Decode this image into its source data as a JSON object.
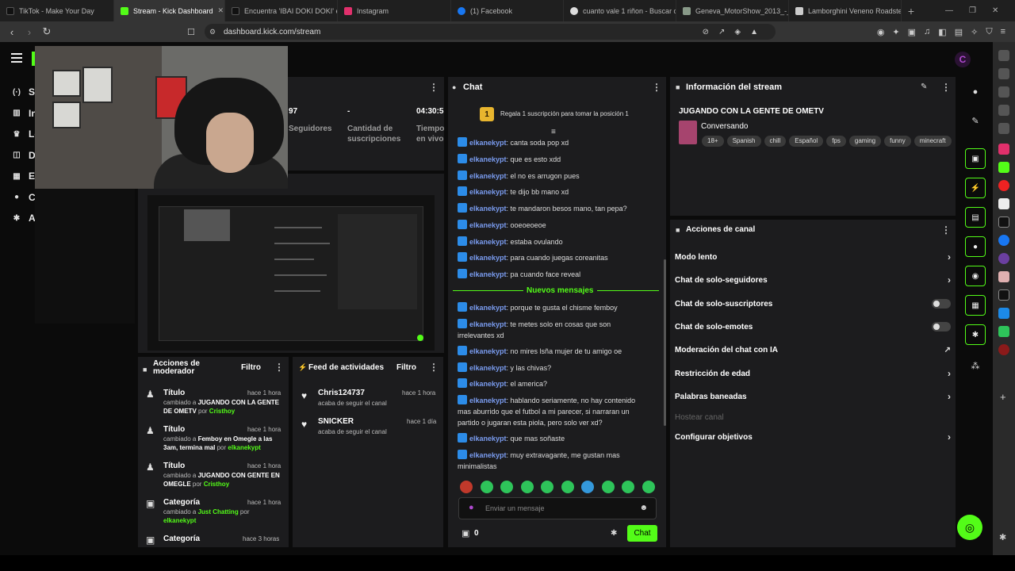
{
  "browser": {
    "tabs": [
      {
        "label": "TikTok - Make Your Day",
        "color": "#111111"
      },
      {
        "label": "Stream - Kick Dashboard",
        "color": "#53fc18",
        "active": true
      },
      {
        "label": "Encuentra 'IBAI DOKI DOKI' en",
        "color": "#111111"
      },
      {
        "label": "Instagram",
        "color": "#e1306c"
      },
      {
        "label": "(1) Facebook",
        "color": "#1877f2"
      },
      {
        "label": "cuanto vale 1 riñon - Buscar co",
        "color": "#dddddd"
      },
      {
        "label": "Geneva_MotorShow_2013_-_La",
        "color": "#889988"
      },
      {
        "label": "Lamborghini Veneno Roadster",
        "color": "#cccccc"
      }
    ],
    "url": "dashboard.kick.com/stream"
  },
  "sidebar": {
    "items": [
      {
        "label": "Str",
        "icon": "broadcast-icon"
      },
      {
        "label": "In",
        "icon": "chart-icon"
      },
      {
        "label": "Lo",
        "icon": "trophy-icon"
      },
      {
        "label": "Dr",
        "icon": "drops-icon"
      },
      {
        "label": "Es",
        "icon": "stats-icon"
      },
      {
        "label": "Canal",
        "icon": "user-icon"
      },
      {
        "label": "Ajustes",
        "icon": "gear-icon"
      }
    ]
  },
  "stats": {
    "followers_value": "97",
    "followers_label": "Seguidores",
    "subs_value": "-",
    "subs_label": "Cantidad de suscripciones",
    "live_value": "04:30:5",
    "live_label": "Tiempo en vivo"
  },
  "mod_actions": {
    "title": "Acciones de moderador",
    "filter": "Filtro",
    "items": [
      {
        "title": "Título",
        "time": "hace 1 hora",
        "pre": "cambiado a ",
        "value": "JUGANDO CON LA GENTE DE OMETV",
        "by": " por ",
        "user": "Cristhoy"
      },
      {
        "title": "Título",
        "time": "hace 1 hora",
        "pre": "cambiado a ",
        "value": "Femboy en Omegle a las 3am, termina mal",
        "by": " por ",
        "user": "elkanekypt"
      },
      {
        "title": "Título",
        "time": "hace 1 hora",
        "pre": "cambiado a ",
        "value": "JUGANDO CON GENTE EN OMEGLE",
        "by": " por ",
        "user": "Cristhoy"
      },
      {
        "title": "Categoría",
        "time": "hace 1 hora",
        "pre": "cambiado a ",
        "value": "Just Chatting",
        "by": " por ",
        "user": "elkanekypt"
      },
      {
        "title": "Categoría",
        "time": "hace 3 horas",
        "pre": "",
        "value": "",
        "by": "",
        "user": ""
      }
    ]
  },
  "activity": {
    "title": "Feed de actividades",
    "filter": "Filtro",
    "items": [
      {
        "name": "Chris124737",
        "desc": "acaba de seguir el canal",
        "time": "hace 1 hora"
      },
      {
        "name": "SNICKER",
        "desc": "acaba de seguir el canal",
        "time": "hace 1 día"
      }
    ]
  },
  "chat": {
    "title": "Chat",
    "gift_number": "1",
    "gift_text": "Regala 1 suscripción para tomar la posición 1",
    "new_messages": "Nuevos mensajes",
    "messages": [
      {
        "user": "elkanekypt",
        "text": "canta soda pop xd"
      },
      {
        "user": "elkanekypt",
        "text": "que es esto xdd"
      },
      {
        "user": "elkanekypt",
        "text": "el no es arrugon pues"
      },
      {
        "user": "elkanekypt",
        "text": "te dijo bb mano xd"
      },
      {
        "user": "elkanekypt",
        "text": "te mandaron besos mano, tan pepa?"
      },
      {
        "user": "elkanekypt",
        "text": "ooeoeoeoe"
      },
      {
        "user": "elkanekypt",
        "text": "estaba ovulando"
      },
      {
        "user": "elkanekypt",
        "text": "para cuando juegas coreanitas"
      },
      {
        "user": "elkanekypt",
        "text": "pa cuando face reveal"
      }
    ],
    "new_list": [
      {
        "user": "elkanekypt",
        "text": "porque te gusta el chisme femboy"
      },
      {
        "user": "elkanekypt",
        "text": "te metes solo en cosas que son irrelevantes xd"
      },
      {
        "user": "elkanekypt",
        "text": "no mires lsña mujer de tu amigo oe"
      },
      {
        "user": "elkanekypt",
        "text": "y las chivas?"
      },
      {
        "user": "elkanekypt",
        "text": "el america?"
      },
      {
        "user": "elkanekypt",
        "text": "hablando seriamente, no hay contenido mas aburrido que el futbol a mi parecer, si narraran un partido o jugaran esta piola, pero solo ver xd?"
      },
      {
        "user": "elkanekypt",
        "text": "que mas soñaste"
      },
      {
        "user": "elkanekypt",
        "text": "muy extravagante, me gustan mas minimalistas"
      }
    ],
    "input_placeholder": "Enviar un mensaje",
    "points": "0",
    "send_label": "Chat"
  },
  "stream_info": {
    "title": "Información del stream",
    "stream_title": "JUGANDO CON LA GENTE DE OMETV",
    "category": "Conversando",
    "tags": [
      "18+",
      "Spanish",
      "chill",
      "Español",
      "fps",
      "gaming",
      "funny",
      "minecraft"
    ]
  },
  "channel_actions": {
    "title": "Acciones de canal",
    "items": [
      {
        "label": "Modo lento",
        "control": "arrow"
      },
      {
        "label": "Chat de solo-seguidores",
        "control": "arrow"
      },
      {
        "label": "Chat de solo-suscriptores",
        "control": "toggle"
      },
      {
        "label": "Chat de solo-emotes",
        "control": "toggle"
      },
      {
        "label": "Moderación del chat con IA",
        "control": "external"
      },
      {
        "label": "Restricción de edad",
        "control": "arrow"
      },
      {
        "label": "Palabras baneadas",
        "control": "arrow"
      },
      {
        "label": "Hostear canal",
        "control": "disabled"
      },
      {
        "label": "Configurar objetivos",
        "control": "arrow"
      }
    ]
  },
  "colors": {
    "accent": "#53fc18",
    "panel": "#1c1c1e",
    "chat_user": "#7a9cf0"
  }
}
